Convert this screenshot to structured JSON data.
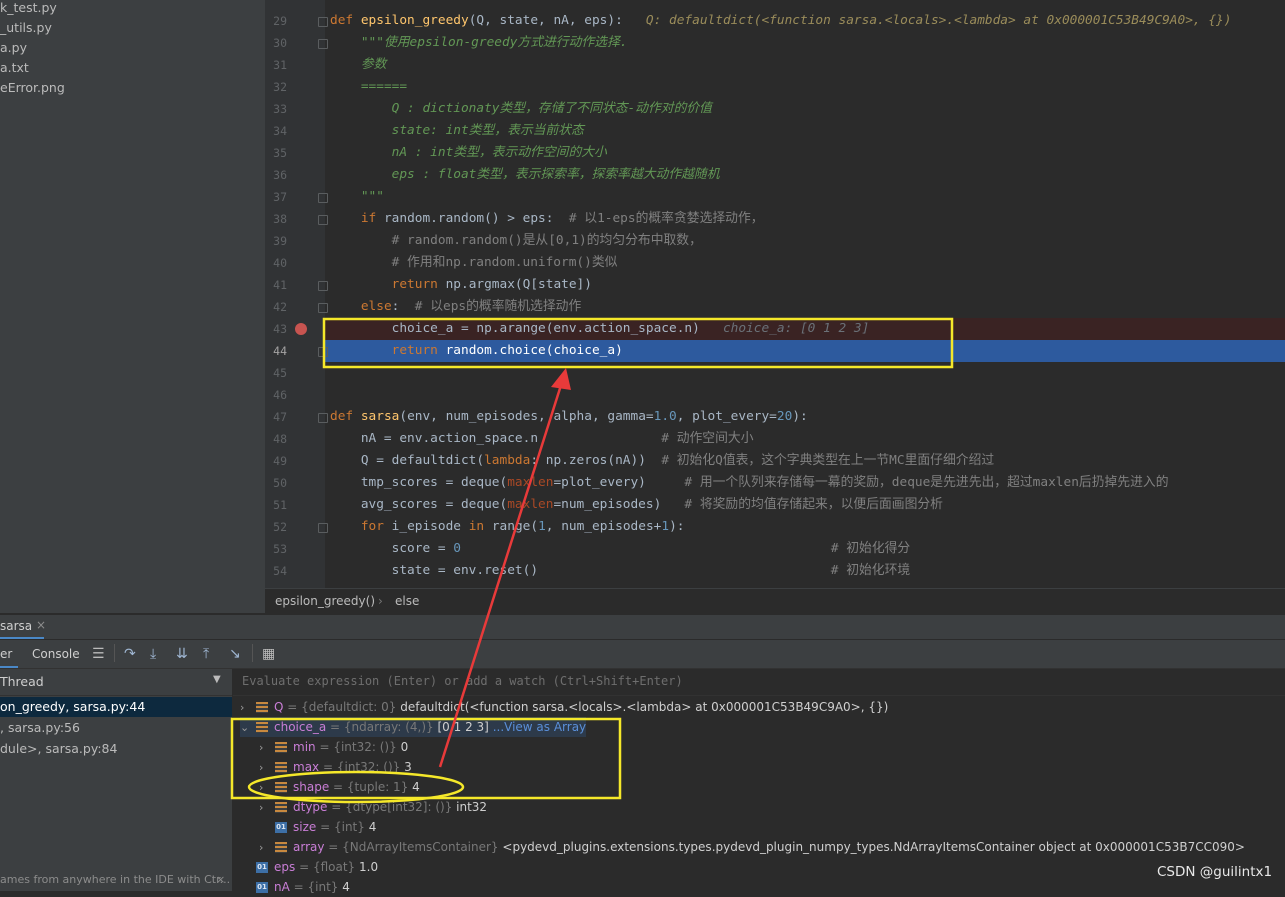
{
  "project_tree": {
    "items": [
      "k_test.py",
      "_utils.py",
      "a.py",
      "a.txt",
      "eError.png"
    ]
  },
  "editor": {
    "lines": [
      {
        "n": "29",
        "html": "<span class='kw'>def </span><span class='fn'>epsilon_greedy</span>(Q, state, nA, eps):   <span class='hintg'>Q: defaultdict(&lt;function sarsa.&lt;locals&gt;.&lt;lambda&gt; at 0x000001C53B49C9A0&gt;, {})</span>"
      },
      {
        "n": "30",
        "html": "    <span class='doc'>\"\"\"使用epsilon-greedy方式进行动作选择.</span>"
      },
      {
        "n": "31",
        "html": "    <span class='doc'>参数</span>"
      },
      {
        "n": "32",
        "html": "    <span class='doc'>======</span>"
      },
      {
        "n": "33",
        "html": "        <span class='doc'>Q : dictionaty类型，存储了不同状态-动作对的价值</span>"
      },
      {
        "n": "34",
        "html": "        <span class='doc'>state: int类型，表示当前状态</span>"
      },
      {
        "n": "35",
        "html": "        <span class='doc'>nA : int类型，表示动作空间的大小</span>"
      },
      {
        "n": "36",
        "html": "        <span class='doc'>eps : float类型，表示探索率，探索率越大动作越随机</span>"
      },
      {
        "n": "37",
        "html": "    <span class='doc'>\"\"\"</span>"
      },
      {
        "n": "38",
        "html": "    <span class='kw'>if </span>random.random() &gt; eps:  <span class='cm'># 以1-eps的概率贪婪选择动作，</span>"
      },
      {
        "n": "39",
        "html": "        <span class='cm'># random.random()是从[0,1)的均匀分布中取数，</span>"
      },
      {
        "n": "40",
        "html": "        <span class='cm'># 作用和np.random.uniform()类似</span>"
      },
      {
        "n": "41",
        "html": "        <span class='kw'>return </span>np.argmax(Q[state])"
      },
      {
        "n": "42",
        "html": "    <span class='kw'>else</span>:  <span class='cm'># 以eps的概率随机选择动作</span>"
      },
      {
        "n": "43",
        "html": "        choice_a = np.arange(env.action_space.n)   <span class='hint'>choice_a: [0 1 2 3]</span>"
      },
      {
        "n": "44",
        "html": "        <span class='kw'>return </span>random.choice(choice_a)"
      },
      {
        "n": "45",
        "html": ""
      },
      {
        "n": "46",
        "html": ""
      },
      {
        "n": "47",
        "html": "<span class='kw'>def </span><span class='fn'>sarsa</span>(env, num_episodes, alpha, gamma=<span class='num'>1.0</span>, plot_every=<span class='num'>20</span>):"
      },
      {
        "n": "48",
        "html": "    nA = env.action_space.n                <span class='cm'># 动作空间大小</span>"
      },
      {
        "n": "49",
        "html": "    Q = defaultdict(<span class='kw'>lambda</span>: np.zeros(nA))  <span class='cm'># 初始化Q值表，这个字典类型在上一节MC里面仔细介绍过</span>"
      },
      {
        "n": "50",
        "html": "    tmp_scores = deque(<span class='kwa'>maxlen</span>=plot_every)     <span class='cm'># 用一个队列来存储每一幕的奖励，deque是先进先出，超过maxlen后扔掉先进入的</span>"
      },
      {
        "n": "51",
        "html": "    avg_scores = deque(<span class='kwa'>maxlen</span>=num_episodes)   <span class='cm'># 将奖励的均值存储起来，以便后面画图分析</span>"
      },
      {
        "n": "52",
        "html": "    <span class='kw'>for </span>i_episode <span class='kw'>in </span>range(<span class='num'>1</span>, num_episodes+<span class='num'>1</span>):"
      },
      {
        "n": "53",
        "html": "        score = <span class='num'>0</span>                                                <span class='cm'># 初始化得分</span>"
      },
      {
        "n": "54",
        "html": "        state = env.reset()                                      <span class='cm'># 初始化环境</span>"
      }
    ]
  },
  "breadcrumb": {
    "func": "epsilon_greedy()",
    "sep": "›",
    "block": "else"
  },
  "debug": {
    "run_tab": "sarsa",
    "tab_debugger": "er",
    "tab_console": "Console",
    "thread_label": "Thread",
    "eval_placeholder": "Evaluate expression (Enter) or add a watch (Ctrl+Shift+Enter)",
    "frames": [
      "on_greedy, sarsa.py:44",
      ", sarsa.py:56",
      "dule>, sarsa.py:84"
    ],
    "frames_hint": "ames from anywhere in the IDE with Ctr...",
    "variables": [
      {
        "indent": 0,
        "arrow": "›",
        "icon": "field",
        "name": "Q",
        "type": "= {defaultdict: 0}",
        "value": "defaultdict(<function sarsa.<locals>.<lambda> at 0x000001C53B49C9A0>, {})"
      },
      {
        "indent": 0,
        "arrow": "⌄",
        "icon": "field",
        "name": "choice_a",
        "type": "= {ndarray: (4,)}",
        "value": "[0 1 2 3]",
        "link": "...View as Array"
      },
      {
        "indent": 1,
        "arrow": "›",
        "icon": "field",
        "name": "min",
        "type": "= {int32: ()}",
        "value": "0"
      },
      {
        "indent": 1,
        "arrow": "›",
        "icon": "field",
        "name": "max",
        "type": "= {int32: ()}",
        "value": "3"
      },
      {
        "indent": 1,
        "arrow": "›",
        "icon": "field",
        "name": "shape",
        "type": "= {tuple: 1}",
        "value": "4"
      },
      {
        "indent": 1,
        "arrow": "›",
        "icon": "field",
        "name": "dtype",
        "type": "= {dtype[int32]: ()}",
        "value": "int32"
      },
      {
        "indent": 1,
        "arrow": "",
        "icon": "int",
        "name": "size",
        "type": "= {int}",
        "value": "4"
      },
      {
        "indent": 1,
        "arrow": "›",
        "icon": "field",
        "name": "array",
        "type": "= {NdArrayItemsContainer}",
        "value": "<pydevd_plugins.extensions.types.pydevd_plugin_numpy_types.NdArrayItemsContainer object at 0x000001C53B7CC090>"
      },
      {
        "indent": 0,
        "arrow": "",
        "icon": "int",
        "name": "eps",
        "type": "= {float}",
        "value": "1.0"
      },
      {
        "indent": 0,
        "arrow": "",
        "icon": "int",
        "name": "nA",
        "type": "= {int}",
        "value": "4"
      }
    ]
  },
  "watermark": "CSDN @guilintx1",
  "colors": {
    "annotation_box": "#f5e82a",
    "annotation_arrow": "#e83a3a",
    "exec_line": "#2d5a9e"
  }
}
